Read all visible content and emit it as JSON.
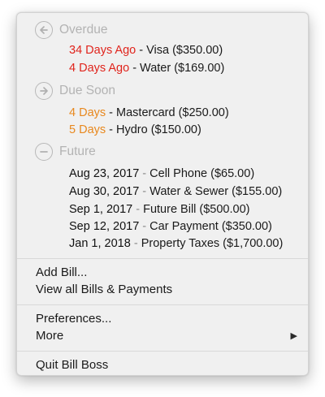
{
  "sections": [
    {
      "label": "Overdue",
      "icon": "arrow-left-circle-icon",
      "bills": [
        {
          "due": "34 Days Ago",
          "rest": " - Visa ($350.00)"
        },
        {
          "due": "4 Days Ago",
          "rest": " - Water ($169.00)"
        }
      ]
    },
    {
      "label": "Due Soon",
      "icon": "arrow-right-circle-icon",
      "bills": [
        {
          "due": "4 Days",
          "rest": " - Mastercard ($250.00)"
        },
        {
          "due": "5 Days",
          "rest": " - Hydro ($150.00)"
        }
      ]
    },
    {
      "label": "Future",
      "icon": "minus-circle-icon",
      "bills": [
        {
          "due": "Aug 23, 2017",
          "sep": " - ",
          "rest": "Cell Phone ($65.00)"
        },
        {
          "due": "Aug 30, 2017",
          "sep": " - ",
          "rest": "Water & Sewer ($155.00)"
        },
        {
          "due": "Sep 1, 2017",
          "sep": " - ",
          "rest": "Future Bill ($500.00)"
        },
        {
          "due": "Sep 12, 2017",
          "sep": " - ",
          "rest": "Car Payment ($350.00)"
        },
        {
          "due": "Jan 1, 2018",
          "sep": " - ",
          "rest": "Property Taxes ($1,700.00)"
        }
      ]
    }
  ],
  "actions": {
    "add_bill": "Add Bill...",
    "view_all": "View all Bills & Payments",
    "preferences": "Preferences...",
    "more": "More",
    "more_arrow": "▶",
    "quit": "Quit Bill Boss"
  },
  "colors": {
    "overdue": "#e0241c",
    "due_soon": "#e8881e",
    "section_label": "#b3b3b3"
  }
}
